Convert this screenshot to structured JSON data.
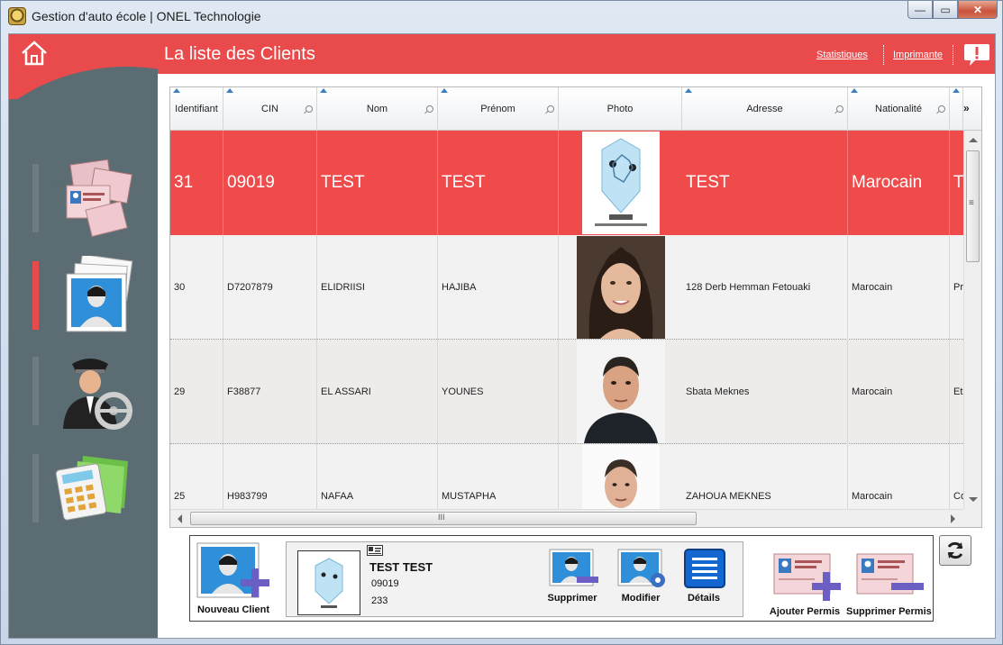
{
  "window": {
    "title": "Gestion d'auto école | ONEL Technologie",
    "minimize": "—",
    "maximize": "▭",
    "close": "✕"
  },
  "header": {
    "title": "La liste des Clients",
    "stats_link": "Statistiques",
    "print_link": "Imprimante"
  },
  "sidebar": {
    "items": [
      {
        "name": "permits",
        "icon": "permit-cards-icon",
        "active": false
      },
      {
        "name": "clients",
        "icon": "client-photos-icon",
        "active": true
      },
      {
        "name": "instructors",
        "icon": "driver-wheel-icon",
        "active": false
      },
      {
        "name": "accounting",
        "icon": "calculator-folder-icon",
        "active": false
      }
    ]
  },
  "grid": {
    "columns": [
      "Identifiant",
      "CIN",
      "Nom",
      "Prénom",
      "Photo",
      "Adresse",
      "Nationalité"
    ],
    "more": "»",
    "rows": [
      {
        "id": "31",
        "cin": "09019",
        "nom": "TEST",
        "prenom": "TEST",
        "photo": "robot-placeholder",
        "adresse": "TEST",
        "nationalite": "Marocain",
        "extra": "T",
        "selected": true
      },
      {
        "id": "30",
        "cin": "D7207879",
        "nom": "ELIDRIISI",
        "prenom": "HAJIBA",
        "photo": "woman-portrait",
        "adresse": "128 Derb Hemman Fetouaki",
        "nationalite": "Marocain",
        "extra": "Pro",
        "selected": false
      },
      {
        "id": "29",
        "cin": "F38877",
        "nom": "EL ASSARI",
        "prenom": "YOUNES",
        "photo": "man-portrait",
        "adresse": "Sbata Meknes",
        "nationalite": "Marocain",
        "extra": "Etu",
        "selected": false
      },
      {
        "id": "25",
        "cin": "H983799",
        "nom": "NAFAA",
        "prenom": "MUSTAPHA",
        "photo": "man-portrait-2",
        "adresse": "ZAHOUA MEKNES",
        "nationalite": "Marocain",
        "extra": "Co",
        "selected": false
      }
    ],
    "hscroll_grip": "III",
    "vscroll_grip": "≡"
  },
  "bottom": {
    "new_client": "Nouveau Client",
    "card": {
      "name": "TEST TEST",
      "cin": "09019",
      "number": "233"
    },
    "delete": "Supprimer",
    "edit": "Modifier",
    "details": "Détails",
    "add_permit": "Ajouter Permis",
    "delete_permit": "Supprimer Permis"
  },
  "colors": {
    "accent": "#e94a4b",
    "sidebar": "#5b6c72"
  }
}
